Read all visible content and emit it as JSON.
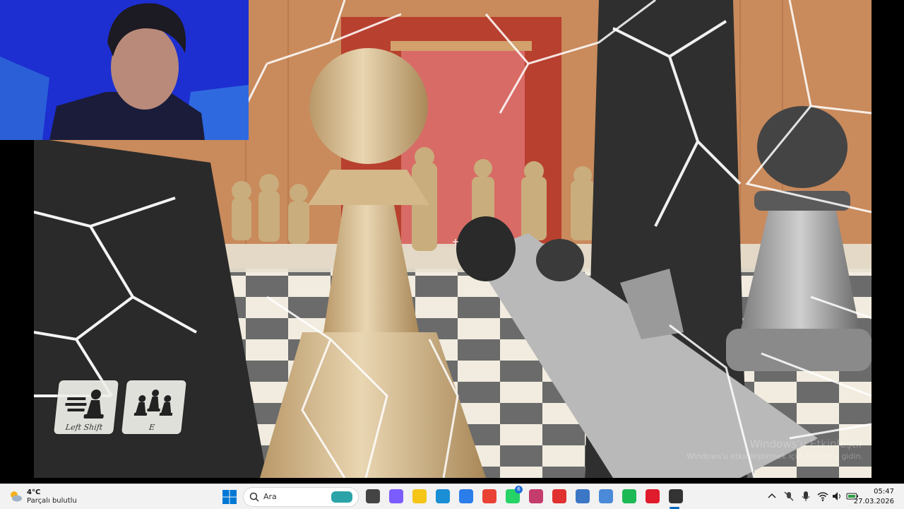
{
  "colors": {
    "wall": "#c98a5c",
    "door": "#d86b66",
    "board_light": "#f1ecdf",
    "board_dark": "#6b6b6b",
    "taskbar": "#f2f2f2",
    "accent": "#0067c0",
    "webcam_bg": "#1d2fd0"
  },
  "hud": {
    "abilities": [
      {
        "key": "Left Shift",
        "icon": "dash-pawn-icon"
      },
      {
        "key": "E",
        "icon": "summon-pawns-icon"
      }
    ],
    "crosshair_icon": "crosshair-icon"
  },
  "watermark": {
    "title": "Windows'u Etkinleştir",
    "subtitle": "Windows'u etkinleştirmek için Ayarlar'a gidin."
  },
  "taskbar": {
    "weather": {
      "temp": "4°C",
      "desc": "Parçalı bulutlu",
      "icon": "partly-cloudy-icon"
    },
    "search_placeholder": "Ara",
    "pinned": [
      {
        "name": "task-view",
        "icon": "task-view-icon",
        "color": "#444444"
      },
      {
        "name": "copilot",
        "icon": "copilot-icon",
        "color": "#7b5cff"
      },
      {
        "name": "file-explorer",
        "icon": "folder-icon",
        "color": "#f5c518"
      },
      {
        "name": "edge",
        "icon": "edge-icon",
        "color": "#1a8fd6"
      },
      {
        "name": "store",
        "icon": "store-icon",
        "color": "#2b7de9"
      },
      {
        "name": "chrome",
        "icon": "chrome-icon",
        "color": "#e94235"
      },
      {
        "name": "whatsapp",
        "icon": "whatsapp-icon",
        "color": "#25d366",
        "badge": "6"
      },
      {
        "name": "snipping",
        "icon": "snipping-icon",
        "color": "#c43c6b"
      },
      {
        "name": "recorder",
        "icon": "recorder-icon",
        "color": "#e03030"
      },
      {
        "name": "calculator",
        "icon": "calculator-icon",
        "color": "#3c77c6"
      },
      {
        "name": "notepad",
        "icon": "notepad-icon",
        "color": "#4a8ad8"
      },
      {
        "name": "spotify",
        "icon": "spotify-icon",
        "color": "#1db954"
      },
      {
        "name": "opera",
        "icon": "opera-icon",
        "color": "#e01b2b"
      },
      {
        "name": "chess-game",
        "icon": "chess-app-icon",
        "color": "#333333"
      }
    ],
    "tray": {
      "icons": [
        "chevron-up-icon",
        "mic-muted-icon",
        "microphone-icon",
        "wifi-icon",
        "speaker-icon",
        "battery-icon"
      ]
    },
    "clock": {
      "time": "05:47",
      "date": "27.03.2026"
    }
  }
}
